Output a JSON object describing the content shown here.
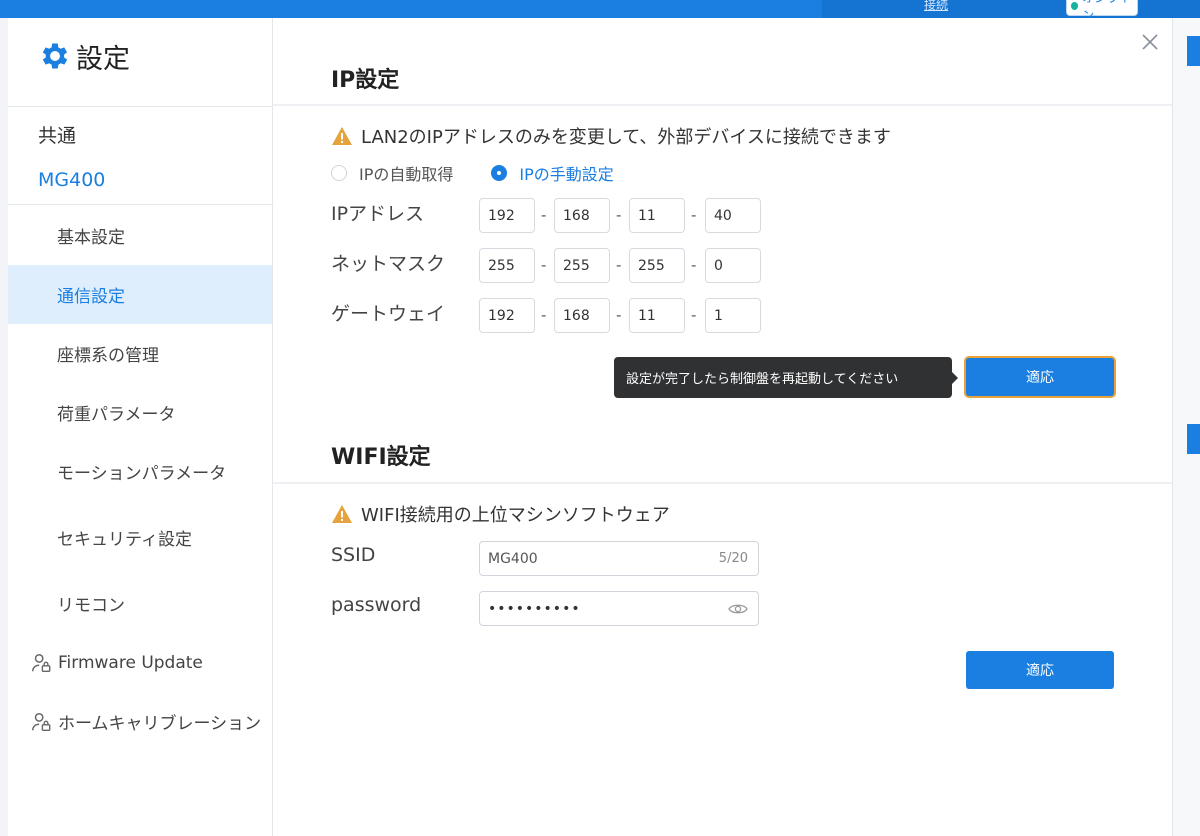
{
  "background": {
    "link_label": "接続",
    "status_label": "オンライン"
  },
  "sidebar": {
    "title": "設定",
    "groups": [
      {
        "label": "共通"
      },
      {
        "label": "MG400"
      }
    ],
    "items": [
      {
        "label": "基本設定"
      },
      {
        "label": "通信設定"
      },
      {
        "label": "座標系の管理"
      },
      {
        "label": "荷重パラメータ"
      },
      {
        "label": "モーションパラメータ"
      },
      {
        "label": "セキュリティ設定"
      },
      {
        "label": "リモコン"
      },
      {
        "label": "Firmware Update",
        "icon": "user-lock-icon"
      },
      {
        "label": "ホームキャリブレーション",
        "icon": "user-lock-icon"
      }
    ]
  },
  "ip_section": {
    "title": "IP設定",
    "warning": "LAN2のIPアドレスのみを変更して、外部デバイスに接続できます",
    "radio_auto": "IPの自動取得",
    "radio_manual": "IPの手動設定",
    "selected_mode": "manual",
    "ip_label": "IPアドレス",
    "ip": [
      "192",
      "168",
      "11",
      "40"
    ],
    "mask_label": "ネットマスク",
    "mask": [
      "255",
      "255",
      "255",
      "0"
    ],
    "gateway_label": "ゲートウェイ",
    "gateway": [
      "192",
      "168",
      "11",
      "1"
    ],
    "tooltip": "設定が完了したら制御盤を再起動してください",
    "apply_label": "適応"
  },
  "wifi_section": {
    "title": "WIFI設定",
    "warning": "WIFI接続用の上位マシンソフトウェア",
    "ssid_label": "SSID",
    "ssid_value": "MG400",
    "ssid_count": "5/20",
    "password_label": "password",
    "password_value": "••••••••••",
    "apply_label": "適応"
  },
  "colors": {
    "accent": "#1a7fe0",
    "warning": "#e6a23c",
    "tooltip_bg": "#303133"
  }
}
